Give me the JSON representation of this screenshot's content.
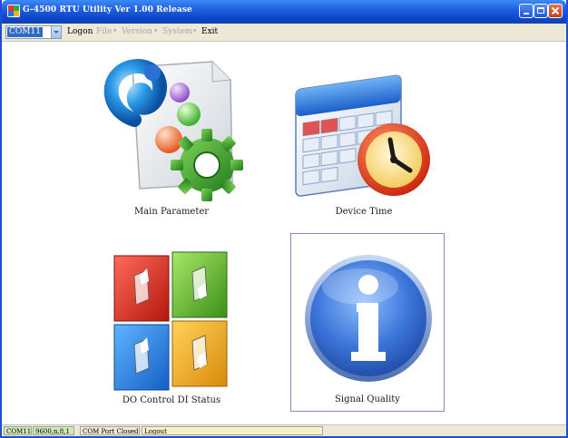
{
  "window": {
    "title": "G-4500 RTU Utility Ver 1.00 Release"
  },
  "menubar": {
    "port_value": "COM11",
    "items": [
      {
        "label": "Logon",
        "enabled": true
      },
      {
        "label": "File",
        "enabled": false
      },
      {
        "label": "Version",
        "enabled": false
      },
      {
        "label": "System",
        "enabled": false
      },
      {
        "label": "Exit",
        "enabled": true
      }
    ],
    "separator": "•"
  },
  "tiles": [
    {
      "label": "Main Parameter",
      "icon": "main-parameter-icon"
    },
    {
      "label": "Device Time",
      "icon": "calendar-clock-icon"
    },
    {
      "label": "DO Control DI Status",
      "icon": "switches-icon"
    },
    {
      "label": "Signal Quality",
      "icon": "info-icon",
      "selected": true
    }
  ],
  "statusbar": {
    "port": "COM11",
    "settings": "9600,n,8,1",
    "port_state": "COM Port Closed",
    "login_state": "Logout"
  },
  "colors": {
    "titlebar": "#1f5fe0",
    "menubar": "#ece9d8",
    "selection_border": "#7a8fb4",
    "status_green": "#cfe8b8",
    "status_yellow": "#f6f1c8"
  }
}
